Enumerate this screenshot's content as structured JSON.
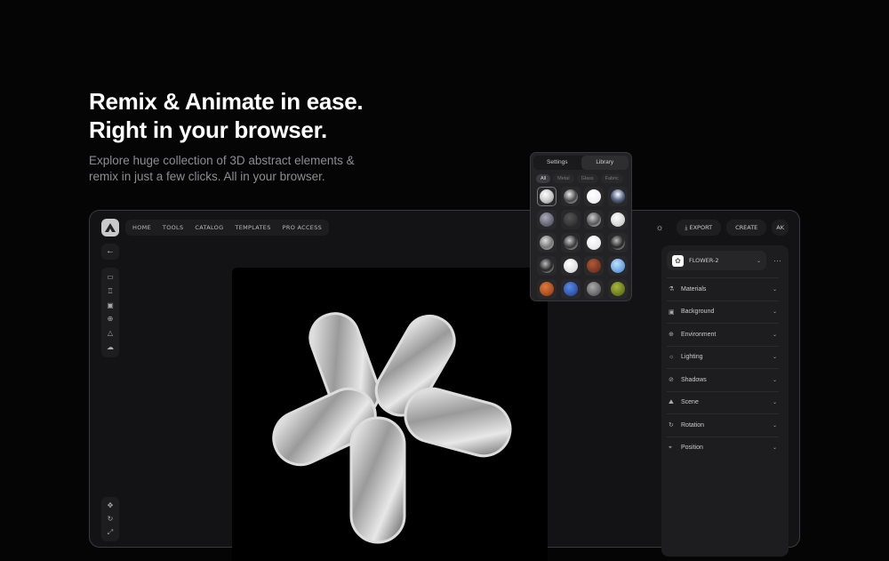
{
  "hero": {
    "title_line1": "Remix & Animate in ease.",
    "title_line2": "Right in your browser.",
    "subtitle": "Explore huge collection of 3D abstract elements & remix in just a few clicks. All in your browser."
  },
  "nav": [
    "HOME",
    "TOOLS",
    "CATALOG",
    "TEMPLATES",
    "PRO ACCESS"
  ],
  "topbar": {
    "export": "EXPORT",
    "create": "CREATE",
    "avatar": "AK"
  },
  "panel": {
    "object": "FLOWER-2",
    "sections": [
      {
        "label": "Materials",
        "icon": "materials-icon",
        "g": "⚗"
      },
      {
        "label": "Background",
        "icon": "image-icon",
        "g": "▣"
      },
      {
        "label": "Environment",
        "icon": "globe-icon",
        "g": "⊕"
      },
      {
        "label": "Lighting",
        "icon": "sun-icon",
        "g": "☼"
      },
      {
        "label": "Shadows",
        "icon": "shadow-icon",
        "g": "⊘"
      },
      {
        "label": "Scene",
        "icon": "scene-icon",
        "g": "⛰"
      },
      {
        "label": "Rotation",
        "icon": "rotation-icon",
        "g": "↻"
      },
      {
        "label": "Position",
        "icon": "position-icon",
        "g": "⌖"
      }
    ]
  },
  "popover": {
    "tabs": [
      "Settings",
      "Library"
    ],
    "filters": [
      "All",
      "Metal",
      "Glass",
      "Fabric"
    ],
    "materials": [
      "radial-gradient(circle at 40% 35%,#fff,#ccc 50%,#777)",
      "radial-gradient(circle at 40% 35%,#eee,#444 55%,#ddd)",
      "radial-gradient(circle at 40% 35%,#fff,#e8e8ea)",
      "radial-gradient(circle at 50% 35%,#fff,#5a6a8a 50%,#111)",
      "radial-gradient(circle at 40% 35%,#aab,#667 60%,#445)",
      "radial-gradient(circle at 40% 35%,#555,#222)",
      "radial-gradient(circle at 40% 35%,#ccc,#555 55%,#eee)",
      "radial-gradient(circle at 40% 35%,#fff,#bbb)",
      "radial-gradient(circle at 40% 35%,#ddd,#777 55%,#bbb)",
      "radial-gradient(circle at 40% 35%,#ccc,#333 55%,#eee)",
      "radial-gradient(circle at 40% 35%,#fff,#ddd)",
      "radial-gradient(circle at 40% 35%,#bbb,#222 55%,#eee)",
      "radial-gradient(circle at 40% 35%,#bbb,#222 55%,#eee)",
      "radial-gradient(circle at 40% 35%,#fff,#ccc)",
      "radial-gradient(circle at 40% 35%,#b05a3a,#5a2414)",
      "radial-gradient(circle at 40% 35%,#bfe0ff,#3a80c8)",
      "radial-gradient(circle at 40% 35%,#e27a3a,#8a3410)",
      "radial-gradient(circle at 40% 35%,#5a8ae8,#1a3a8a)",
      "radial-gradient(circle at 40% 35%,#aaa,#444)",
      "radial-gradient(circle at 40% 35%,#a8b83a,#4a5a10)"
    ]
  }
}
